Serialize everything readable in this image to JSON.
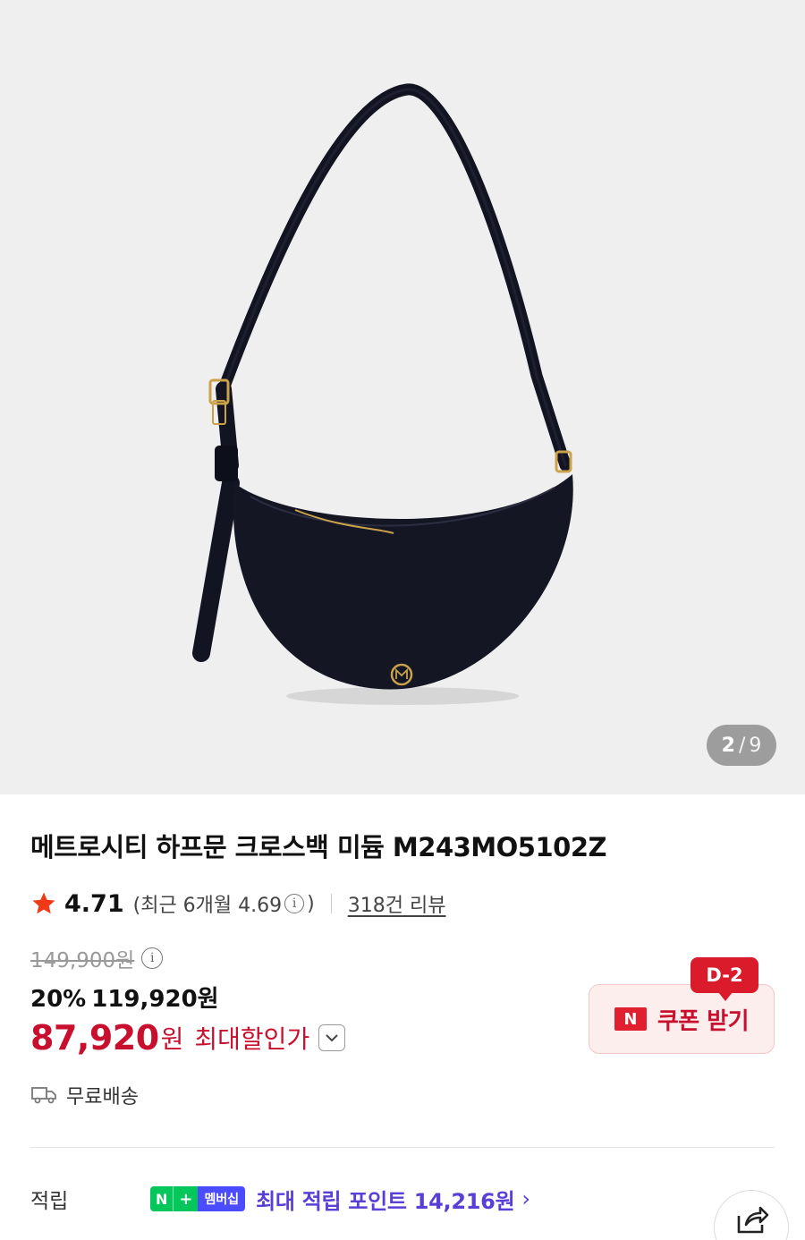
{
  "gallery": {
    "current": "2",
    "separator": "/",
    "total": "9"
  },
  "product": {
    "title": "메트로시티 하프문 크로스백 미듐 M243MO5102Z",
    "rating": "4.71",
    "recent_rating": "(최근 6개월 4.69",
    "recent_rating_close": ")",
    "review_count": "318건 리뷰",
    "original_price": "149,900원",
    "discount_percent": "20%",
    "discount_price": "119,920원",
    "final_price": "87,920",
    "final_currency": "원",
    "max_discount_label": "최대할인가",
    "shipping": "무료배송"
  },
  "coupon": {
    "badge": "D-2",
    "brand_letter": "N",
    "label": "쿠폰 받기"
  },
  "points": {
    "label": "적립",
    "membership_n": "N",
    "membership_plus": "+",
    "membership_text": "멤버십",
    "text": "최대 적립 포인트 14,216원",
    "chevron": "›"
  },
  "colors": {
    "accent_red": "#c8102e",
    "points_purple": "#5a3fd6",
    "naver_green": "#03c75a"
  }
}
